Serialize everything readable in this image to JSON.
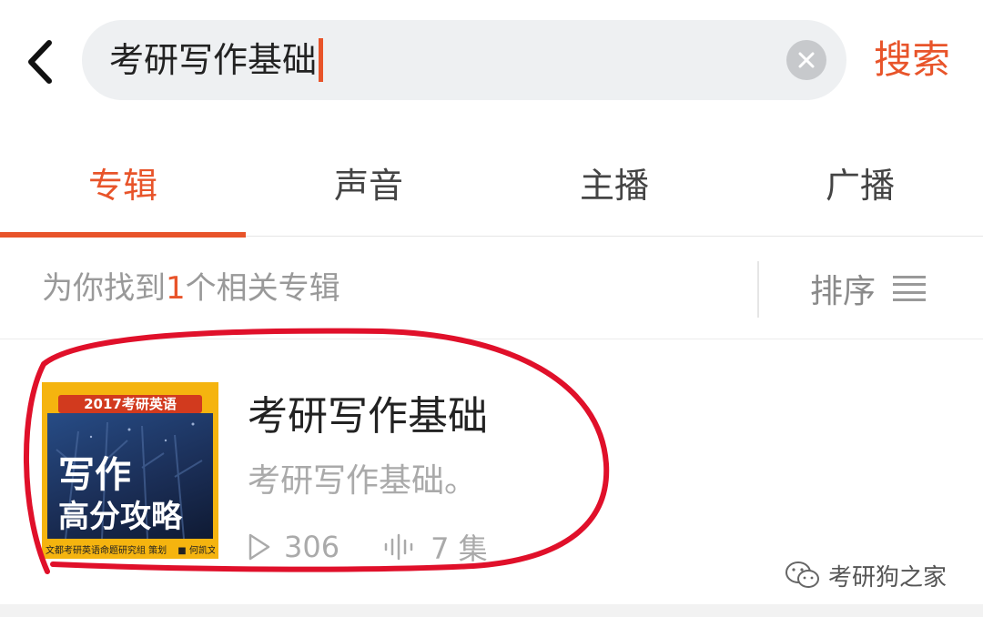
{
  "search": {
    "query": "考研写作基础",
    "submit_label": "搜索"
  },
  "tabs": [
    {
      "label": "专辑",
      "active": true
    },
    {
      "label": "声音",
      "active": false
    },
    {
      "label": "主播",
      "active": false
    },
    {
      "label": "广播",
      "active": false
    }
  ],
  "results": {
    "prefix": "为你找到",
    "count": "1",
    "suffix": "个相关专辑",
    "sort_label": "排序"
  },
  "album": {
    "title": "考研写作基础",
    "description": "考研写作基础。",
    "plays": "306",
    "episodes": "7 集",
    "cover": {
      "banner": "2017考研英语",
      "title_line1": "写作",
      "title_line2": "高分攻略",
      "footer_left": "文都考研英语命题研究组 策划",
      "footer_right": "■ 何凯文 编著"
    }
  },
  "watermark": "考研狗之家",
  "colors": {
    "accent": "#e8542a",
    "highlight_circle": "#e0102a",
    "cover_yellow": "#f5b40f",
    "cover_blue": "#1b2f58"
  }
}
